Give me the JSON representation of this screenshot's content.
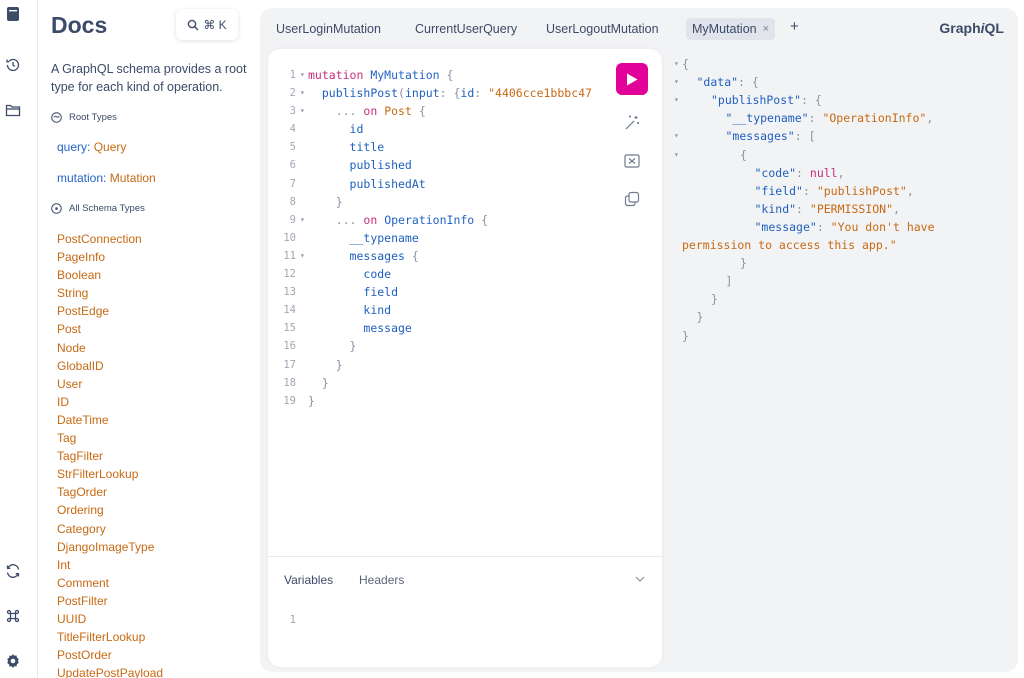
{
  "rail": {
    "icons": [
      "docs-icon",
      "history-icon",
      "explorer-icon",
      "refetch-icon",
      "shortcuts-icon",
      "settings-icon"
    ]
  },
  "docs": {
    "title": "Docs",
    "search_shortcut": "⌘ K",
    "description": "A GraphQL schema provides a root type for each kind of operation.",
    "root_types_label": "Root Types",
    "root_types": [
      {
        "key": "query",
        "sep": ": ",
        "type": "Query"
      },
      {
        "key": "mutation",
        "sep": ": ",
        "type": "Mutation"
      }
    ],
    "all_types_label": "All Schema Types",
    "types": [
      "PostConnection",
      "PageInfo",
      "Boolean",
      "String",
      "PostEdge",
      "Post",
      "Node",
      "GlobalID",
      "User",
      "ID",
      "DateTime",
      "Tag",
      "TagFilter",
      "StrFilterLookup",
      "TagOrder",
      "Ordering",
      "Category",
      "DjangoImageType",
      "Int",
      "Comment",
      "PostFilter",
      "UUID",
      "TitleFilterLookup",
      "PostOrder",
      "UpdatePostPayload"
    ]
  },
  "tabs": [
    {
      "label": "UserLoginMutation"
    },
    {
      "label": "CurrentUserQuery"
    },
    {
      "label": "UserLogoutMutation"
    },
    {
      "label": "MyMutation",
      "close": "×"
    }
  ],
  "add_tab": "+",
  "logo": {
    "pre": "Graph",
    "em": "i",
    "post": "QL"
  },
  "editor": {
    "line_numbers": [
      "1",
      "2",
      "3",
      "4",
      "5",
      "6",
      "7",
      "8",
      "9",
      "10",
      "11",
      "12",
      "13",
      "14",
      "15",
      "16",
      "17",
      "18",
      "19"
    ],
    "folds": [
      "▾",
      "▾",
      "▾",
      "",
      "",
      "",
      "",
      "",
      "▾",
      "",
      "▾",
      "",
      "",
      "",
      "",
      "",
      "",
      "",
      ""
    ],
    "l1": {
      "kw": "mutation",
      "name": "MyMutation",
      "brace": " {"
    },
    "l2": {
      "fld": "publishPost",
      "open": "(",
      "arg": "input",
      "colon": ": ",
      "ob": "{",
      "arg2": "id",
      "colon2": ": ",
      "str": "\"4406cce1bbbc47"
    },
    "l3": {
      "spread": "... ",
      "kw": "on",
      "type": "Post",
      "brace": " {"
    },
    "l4": "id",
    "l5": "title",
    "l6": "published",
    "l7": "publishedAt",
    "l8": "}",
    "l9": {
      "spread": "... ",
      "kw": "on",
      "type": "OperationInfo",
      "brace": " {"
    },
    "l10": "__typename",
    "l11": {
      "fld": "messages",
      "brace": " {"
    },
    "l12": "code",
    "l13": "field",
    "l14": "kind",
    "l15": "message",
    "l16": "}",
    "l17": "}",
    "l18": "}",
    "l19": "}"
  },
  "variables": {
    "tab_variables": "Variables",
    "tab_headers": "Headers",
    "line_number": "1"
  },
  "result": {
    "lines": [
      {
        "fold": "▾",
        "text": "{"
      },
      {
        "fold": "▾",
        "key": "\"data\"",
        "after": ": {"
      },
      {
        "fold": "▾",
        "key": "\"publishPost\"",
        "after": ": {"
      },
      {
        "fold": "",
        "key": "\"__typename\"",
        "after": ": ",
        "val": "\"OperationInfo\"",
        "tail": ","
      },
      {
        "fold": "▾",
        "key": "\"messages\"",
        "after": ": ["
      },
      {
        "fold": "▾",
        "text": "{"
      },
      {
        "fold": "",
        "key": "\"code\"",
        "after": ": ",
        "null": "null",
        "tail": ","
      },
      {
        "fold": "",
        "key": "\"field\"",
        "after": ": ",
        "val": "\"publishPost\"",
        "tail": ","
      },
      {
        "fold": "",
        "key": "\"kind\"",
        "after": ": ",
        "val": "\"PERMISSION\"",
        "tail": ","
      },
      {
        "fold": "",
        "key": "\"message\"",
        "after": ": ",
        "val": "\"You don't have"
      },
      {
        "fold": "",
        "val": "permission to access this app.\""
      },
      {
        "fold": "",
        "text": "}"
      },
      {
        "fold": "",
        "text": "]"
      },
      {
        "fold": "",
        "text": "}"
      },
      {
        "fold": "",
        "text": "}"
      },
      {
        "fold": "",
        "text": "}"
      }
    ]
  },
  "colors": {
    "run": "#e10098",
    "keyword": "#c62f7a",
    "field": "#1f5fbf",
    "string": "#c66a14",
    "type": "#c66a14"
  }
}
